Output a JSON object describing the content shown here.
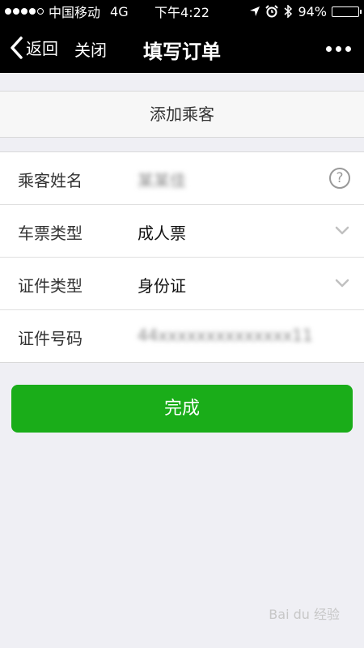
{
  "status_bar": {
    "carrier": "中国移动",
    "network": "4G",
    "time": "下午4:22",
    "battery_percent": "94%",
    "battery_level": 0.94,
    "signal_bars_filled": 4,
    "signal_bars_total": 5,
    "icons": [
      "location-arrow-icon",
      "alarm-icon",
      "bluetooth-icon"
    ]
  },
  "nav": {
    "back_label": "返回",
    "close_label": "关闭",
    "title": "填写订单",
    "more_icon": "more-dots-icon"
  },
  "add_passenger_label": "添加乘客",
  "form": {
    "rows": [
      {
        "label": "乘客姓名",
        "value": "某某佳",
        "obscured": true,
        "icon": "help-circle-icon"
      },
      {
        "label": "车票类型",
        "value": "成人票",
        "icon": "chevron-down-icon"
      },
      {
        "label": "证件类型",
        "value": "身份证",
        "icon": "chevron-down-icon"
      },
      {
        "label": "证件号码",
        "value": "44xxxxxxxxxxxxxx11",
        "obscured": true
      }
    ]
  },
  "done_label": "完成",
  "watermark": "Bai du 经验",
  "colors": {
    "header_bg": "#000000",
    "page_bg": "#efeff4",
    "primary_green": "#1aad19"
  }
}
